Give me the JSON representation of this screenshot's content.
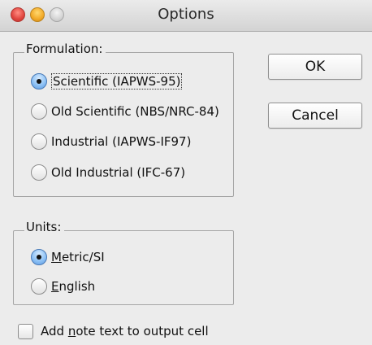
{
  "window": {
    "title": "Options",
    "controls": [
      "close-icon",
      "minimize-icon",
      "zoom-icon"
    ]
  },
  "formulation": {
    "legend": "Formulation:",
    "options": [
      {
        "label": "Scientific (IAPWS-95)",
        "checked": true
      },
      {
        "label": "Old Scientific (NBS/NRC-84)",
        "checked": false
      },
      {
        "label": "Industrial (IAPWS-IF97)",
        "checked": false
      },
      {
        "label": "Old Industrial (IFC-67)",
        "checked": false
      }
    ]
  },
  "units": {
    "legend": "Units:",
    "options": [
      {
        "mnemonic": "M",
        "rest": "etric/SI",
        "checked": true
      },
      {
        "mnemonic": "E",
        "rest": "nglish",
        "checked": false
      }
    ]
  },
  "buttons": {
    "ok": "OK",
    "cancel": "Cancel"
  },
  "note_checkbox": {
    "pre": "Add ",
    "mnemonic": "n",
    "post": "ote text to output cell",
    "checked": false
  }
}
